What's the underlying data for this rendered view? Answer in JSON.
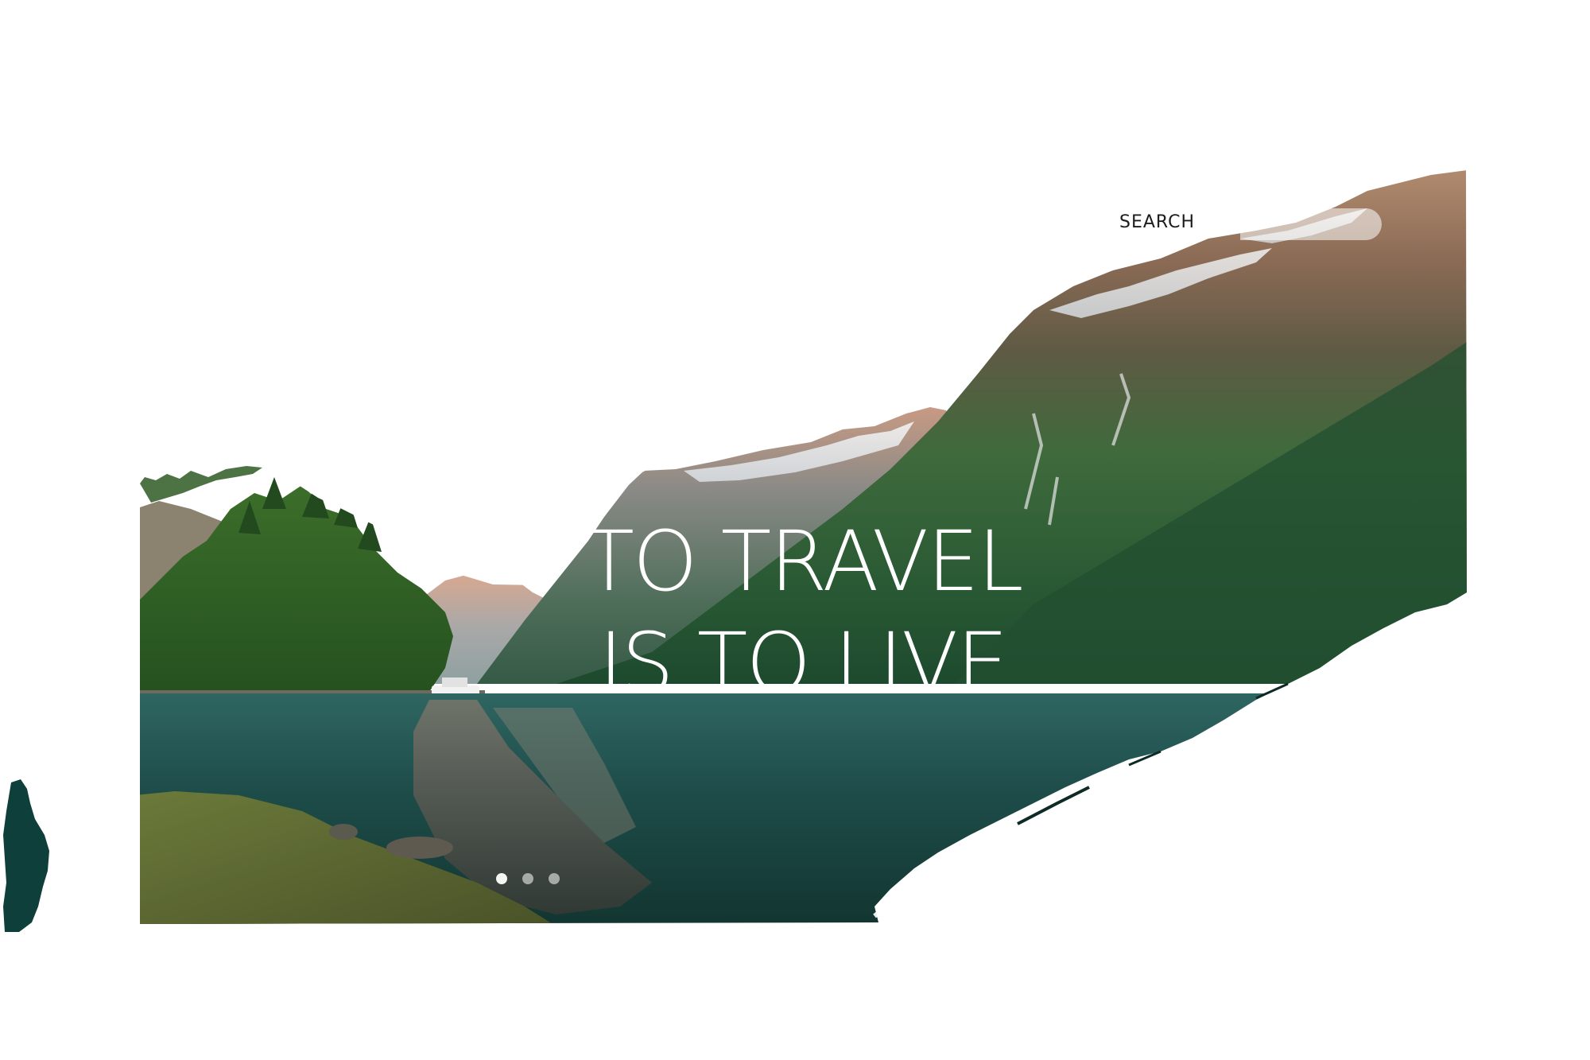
{
  "search": {
    "label": "SEARCH",
    "value": ""
  },
  "hero": {
    "headline_line1": "TO TRAVEL",
    "headline_line2": "IS TO LIVE"
  },
  "carousel": {
    "slide_count": 3,
    "active_index": 0
  },
  "colors": {
    "sky": "#ffffff",
    "forest_dark": "#1f4a30",
    "water": "#153c3a",
    "accent_ink": "#0f3f3a"
  }
}
